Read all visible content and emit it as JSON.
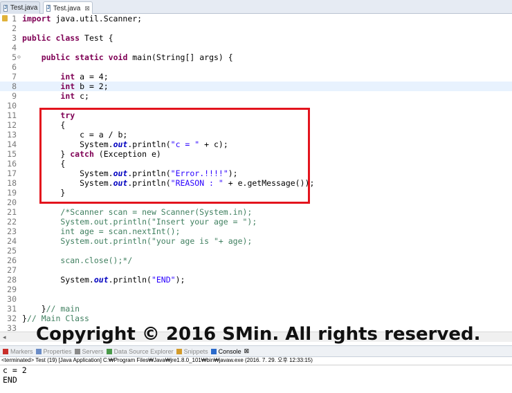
{
  "tabs": [
    {
      "label": "Test.java",
      "active": false
    },
    {
      "label": "Test.java",
      "active": true,
      "close": "⊠"
    }
  ],
  "code_lines": [
    {
      "n": "1",
      "tokens": [
        {
          "t": "import",
          "c": "kw"
        },
        {
          "t": " java.util.Scanner;"
        }
      ]
    },
    {
      "n": "2",
      "tokens": []
    },
    {
      "n": "3",
      "tokens": [
        {
          "t": "public",
          "c": "kw"
        },
        {
          "t": " "
        },
        {
          "t": "class",
          "c": "kw"
        },
        {
          "t": " Test {"
        }
      ]
    },
    {
      "n": "4",
      "tokens": []
    },
    {
      "n": "5",
      "fold": "⊖",
      "tokens": [
        {
          "t": "    "
        },
        {
          "t": "public",
          "c": "kw"
        },
        {
          "t": " "
        },
        {
          "t": "static",
          "c": "kw"
        },
        {
          "t": " "
        },
        {
          "t": "void",
          "c": "kw"
        },
        {
          "t": " main(String[] args) {"
        }
      ]
    },
    {
      "n": "6",
      "tokens": []
    },
    {
      "n": "7",
      "tokens": [
        {
          "t": "        "
        },
        {
          "t": "int",
          "c": "kw"
        },
        {
          "t": " a = 4;"
        }
      ]
    },
    {
      "n": "8",
      "current": true,
      "tokens": [
        {
          "t": "        "
        },
        {
          "t": "int",
          "c": "kw"
        },
        {
          "t": " b = 2;"
        }
      ]
    },
    {
      "n": "9",
      "tokens": [
        {
          "t": "        "
        },
        {
          "t": "int",
          "c": "kw"
        },
        {
          "t": " c;"
        }
      ]
    },
    {
      "n": "10",
      "tokens": []
    },
    {
      "n": "11",
      "tokens": [
        {
          "t": "        "
        },
        {
          "t": "try",
          "c": "kw"
        }
      ]
    },
    {
      "n": "12",
      "tokens": [
        {
          "t": "        {"
        }
      ]
    },
    {
      "n": "13",
      "tokens": [
        {
          "t": "            c = a / b;"
        }
      ]
    },
    {
      "n": "14",
      "tokens": [
        {
          "t": "            System."
        },
        {
          "t": "out",
          "c": "fld"
        },
        {
          "t": ".println("
        },
        {
          "t": "\"c = \"",
          "c": "str"
        },
        {
          "t": " + c);"
        }
      ]
    },
    {
      "n": "15",
      "tokens": [
        {
          "t": "        } "
        },
        {
          "t": "catch",
          "c": "kw"
        },
        {
          "t": " (Exception e)"
        }
      ]
    },
    {
      "n": "16",
      "tokens": [
        {
          "t": "        {"
        }
      ]
    },
    {
      "n": "17",
      "tokens": [
        {
          "t": "            System."
        },
        {
          "t": "out",
          "c": "fld"
        },
        {
          "t": ".println("
        },
        {
          "t": "\"Error.!!!!\"",
          "c": "str"
        },
        {
          "t": ");"
        }
      ]
    },
    {
      "n": "18",
      "tokens": [
        {
          "t": "            System."
        },
        {
          "t": "out",
          "c": "fld"
        },
        {
          "t": ".println("
        },
        {
          "t": "\"REASON : \"",
          "c": "str"
        },
        {
          "t": " + e.getMessage());"
        }
      ]
    },
    {
      "n": "19",
      "tokens": [
        {
          "t": "        }"
        }
      ]
    },
    {
      "n": "20",
      "tokens": []
    },
    {
      "n": "21",
      "tokens": [
        {
          "t": "        "
        },
        {
          "t": "/*Scanner scan = new Scanner(System.in);",
          "c": "cmt"
        }
      ]
    },
    {
      "n": "22",
      "tokens": [
        {
          "t": "        "
        },
        {
          "t": "System.out.println(\"Insert your age = \");",
          "c": "cmt"
        }
      ]
    },
    {
      "n": "23",
      "tokens": [
        {
          "t": "        "
        },
        {
          "t": "int age = scan.nextInt();",
          "c": "cmt"
        }
      ]
    },
    {
      "n": "24",
      "tokens": [
        {
          "t": "        "
        },
        {
          "t": "System.out.println(\"your age is \"+ age);",
          "c": "cmt"
        }
      ]
    },
    {
      "n": "25",
      "tokens": []
    },
    {
      "n": "26",
      "tokens": [
        {
          "t": "        "
        },
        {
          "t": "scan.close();*/",
          "c": "cmt"
        }
      ]
    },
    {
      "n": "27",
      "tokens": []
    },
    {
      "n": "28",
      "tokens": [
        {
          "t": "        System."
        },
        {
          "t": "out",
          "c": "fld"
        },
        {
          "t": ".println("
        },
        {
          "t": "\"END\"",
          "c": "str"
        },
        {
          "t": ");"
        }
      ]
    },
    {
      "n": "29",
      "tokens": []
    },
    {
      "n": "30",
      "tokens": []
    },
    {
      "n": "31",
      "tokens": [
        {
          "t": "    }"
        },
        {
          "t": "// main",
          "c": "cmt"
        }
      ]
    },
    {
      "n": "32",
      "tokens": [
        {
          "t": "}"
        },
        {
          "t": "// Main Class",
          "c": "cmt"
        }
      ]
    },
    {
      "n": "33",
      "tokens": []
    }
  ],
  "watermark": "Copyright © 2016 SMin. All rights reserved.",
  "console": {
    "tabs": [
      {
        "label": "Markers",
        "icon": "markers-icon",
        "active": false
      },
      {
        "label": "Properties",
        "icon": "properties-icon",
        "active": false
      },
      {
        "label": "Servers",
        "icon": "servers-icon",
        "active": false
      },
      {
        "label": "Data Source Explorer",
        "icon": "data-source-icon",
        "active": false
      },
      {
        "label": "Snippets",
        "icon": "snippets-icon",
        "active": false
      },
      {
        "label": "Console",
        "icon": "console-icon",
        "active": true,
        "close": "⊠"
      }
    ],
    "status": "<terminated> Test (19) [Java Application] C:₩Program Files₩Java₩jre1.8.0_101₩bin₩javaw.exe (2016. 7. 29. 오후 12:33:15)",
    "output": [
      "c = 2",
      "END"
    ]
  }
}
